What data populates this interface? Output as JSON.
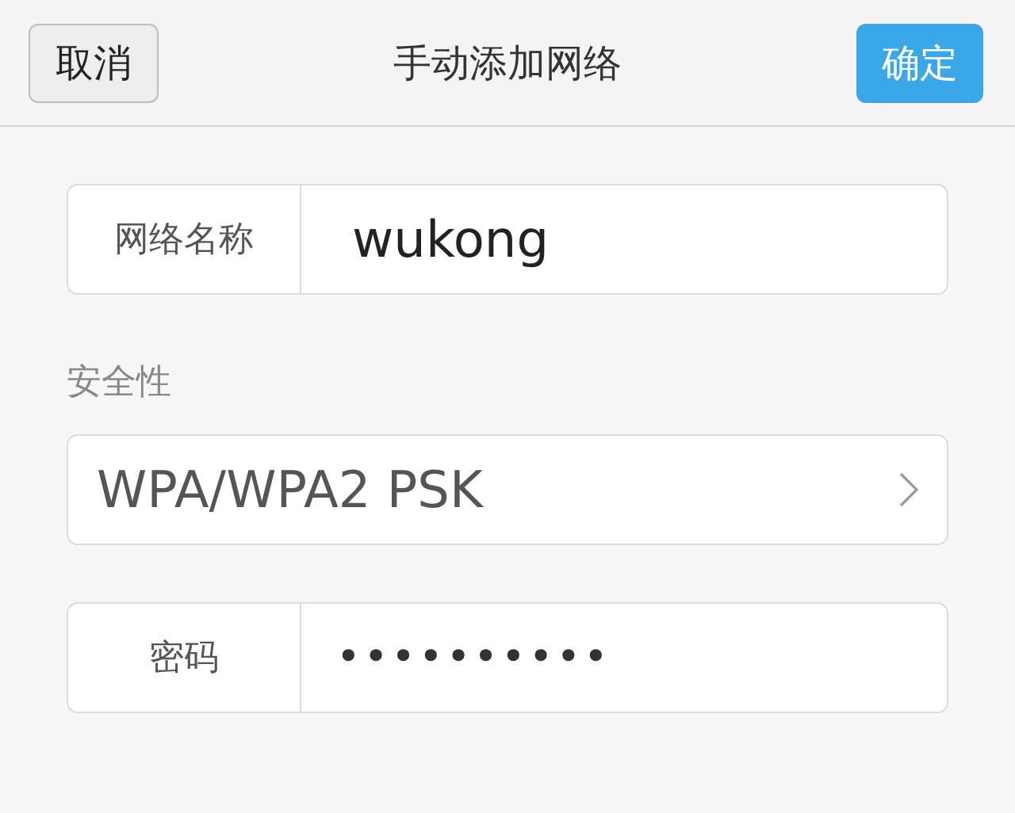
{
  "header": {
    "cancel": "取消",
    "title": "手动添加网络",
    "confirm": "确定"
  },
  "fields": [
    {
      "kind": "text",
      "label": "网络名称",
      "value": "wukong"
    },
    {
      "kind": "section",
      "label": "安全性"
    },
    {
      "kind": "select",
      "value": "WPA/WPA2 PSK"
    },
    {
      "kind": "password",
      "label": "密码",
      "value": "••••••••••"
    }
  ]
}
